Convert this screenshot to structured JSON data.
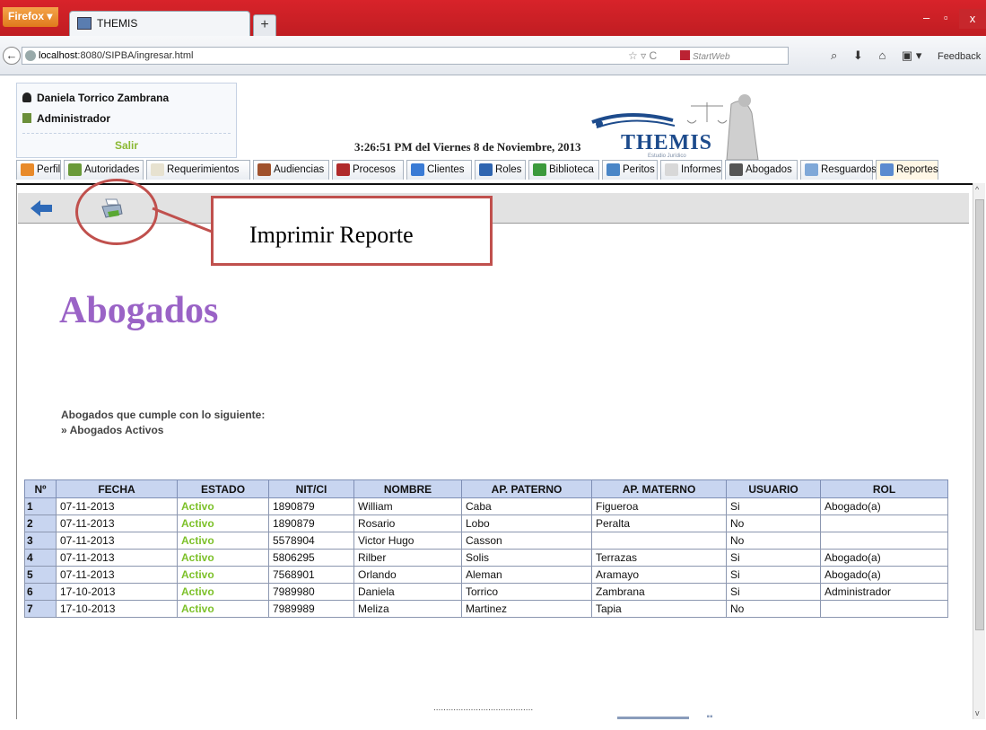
{
  "browser": {
    "app_button": "Firefox",
    "tab_title": "THEMIS",
    "new_tab": "+",
    "url_host": "localhost",
    "url_rest": ":8080/SIPBA/ingresar.html",
    "search_placeholder": "StartWeb",
    "feedback": "Feedback",
    "window_min": "–",
    "window_max": "▫",
    "window_close": "x"
  },
  "user": {
    "name": "Daniela Torrico Zambrana",
    "role": "Administrador",
    "logout": "Salir"
  },
  "clock": "3:26:51 PM del Viernes 8 de Noviembre, 2013",
  "logo": {
    "title": "THEMIS",
    "subtitle": "Estudio Jurídico"
  },
  "menu": [
    {
      "label": "Perfil",
      "icon": "profile-icon",
      "color": "#e88a2a"
    },
    {
      "label": "Autoridades",
      "icon": "authorities-icon",
      "color": "#6a9a3a"
    },
    {
      "label": "Requerimientos",
      "icon": "requirements-icon",
      "color": "#e7e2d0"
    },
    {
      "label": "Audiencias",
      "icon": "hearings-icon",
      "color": "#a0522d"
    },
    {
      "label": "Procesos",
      "icon": "processes-icon",
      "color": "#b02a2a"
    },
    {
      "label": "Clientes",
      "icon": "clients-icon",
      "color": "#3a7bd5"
    },
    {
      "label": "Roles",
      "icon": "roles-icon",
      "color": "#2f65b0"
    },
    {
      "label": "Biblioteca",
      "icon": "library-icon",
      "color": "#3c9a3c"
    },
    {
      "label": "Peritos",
      "icon": "experts-icon",
      "color": "#4a86c7"
    },
    {
      "label": "Informes",
      "icon": "reports-icon",
      "color": "#d8d8d8"
    },
    {
      "label": "Abogados",
      "icon": "lawyers-icon",
      "color": "#555555"
    },
    {
      "label": "Resguardos",
      "icon": "safekeeping-icon",
      "color": "#7fa8d8"
    },
    {
      "label": "Reportes",
      "icon": "reports-folder-icon",
      "color": "#5b8bd0"
    }
  ],
  "callout": "Imprimir Reporte",
  "page_title": "Abogados",
  "criteria": {
    "heading": "Abogados que cumple con lo siguiente:",
    "item": "» Abogados Activos"
  },
  "table": {
    "headers": [
      "Nº",
      "FECHA",
      "ESTADO",
      "NIT/CI",
      "NOMBRE",
      "AP. PATERNO",
      "AP. MATERNO",
      "USUARIO",
      "ROL"
    ],
    "rows": [
      [
        "1",
        "07-11-2013",
        "Activo",
        "1890879",
        "William",
        "Caba",
        "Figueroa",
        "Si",
        "Abogado(a)"
      ],
      [
        "2",
        "07-11-2013",
        "Activo",
        "1890879",
        "Rosario",
        "Lobo",
        "Peralta",
        "No",
        ""
      ],
      [
        "3",
        "07-11-2013",
        "Activo",
        "5578904",
        "Victor Hugo",
        "Casson",
        "",
        "No",
        ""
      ],
      [
        "4",
        "07-11-2013",
        "Activo",
        "5806295",
        "Rilber",
        "Solis",
        "Terrazas",
        "Si",
        "Abogado(a)"
      ],
      [
        "5",
        "07-11-2013",
        "Activo",
        "7568901",
        "Orlando",
        "Aleman",
        "Aramayo",
        "Si",
        "Abogado(a)"
      ],
      [
        "6",
        "17-10-2013",
        "Activo",
        "7989980",
        "Daniela",
        "Torrico",
        "Zambrana",
        "Si",
        "Administrador"
      ],
      [
        "7",
        "17-10-2013",
        "Activo",
        "7989989",
        "Meliza",
        "Martinez",
        "Tapia",
        "No",
        ""
      ]
    ]
  },
  "footer_dots": "........................................"
}
